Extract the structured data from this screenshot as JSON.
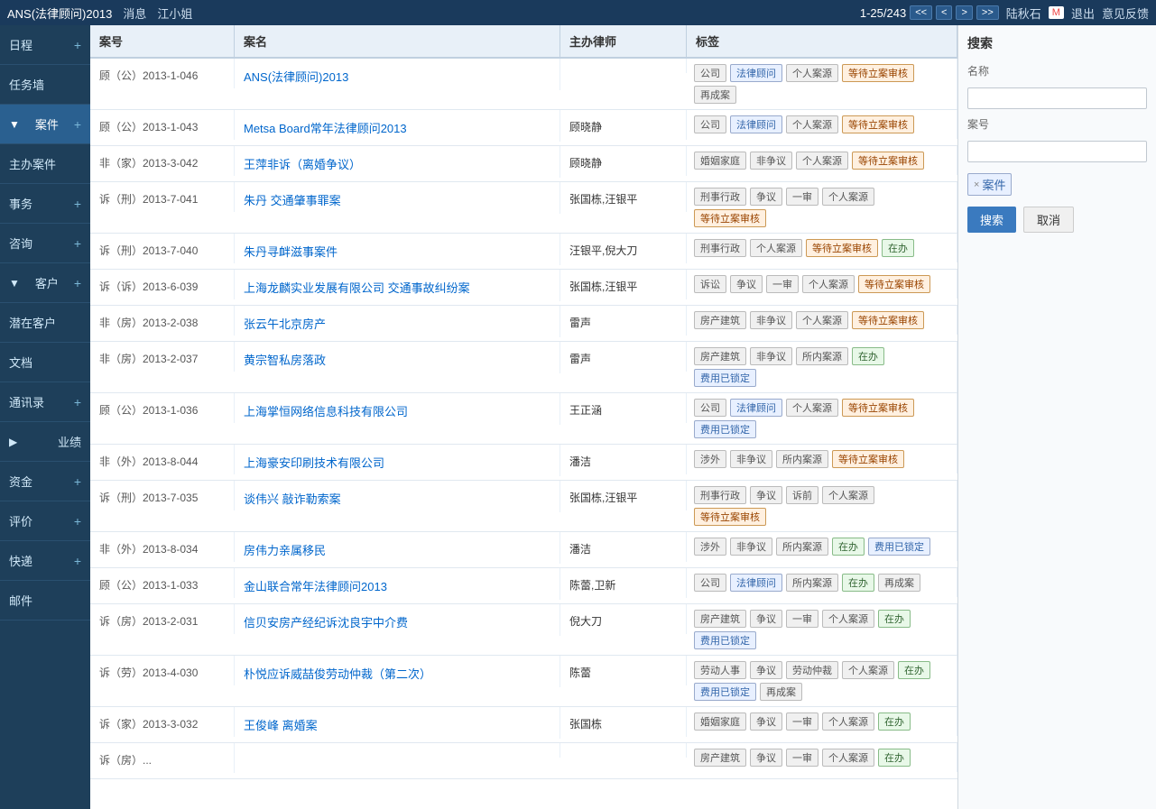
{
  "topbar": {
    "title": "ANS(法律顾问)2013",
    "links": [
      "消息",
      "江小姐"
    ],
    "pagination": "1-25/243",
    "nav_buttons": [
      "<<",
      "<",
      ">",
      ">>"
    ],
    "user": "陆秋石",
    "mail_icon": "M",
    "actions": [
      "退出",
      "意见反馈"
    ]
  },
  "sidebar": {
    "items": [
      {
        "label": "日程",
        "suffix": "+",
        "active": false
      },
      {
        "label": "任务墙",
        "suffix": "",
        "active": false
      },
      {
        "label": "案件",
        "suffix": "+",
        "active": true,
        "arrow": "▼"
      },
      {
        "label": "主办案件",
        "suffix": "",
        "active": false
      },
      {
        "label": "事务",
        "suffix": "+",
        "active": false
      },
      {
        "label": "咨询",
        "suffix": "+",
        "active": false
      },
      {
        "label": "客户",
        "suffix": "+",
        "active": false,
        "arrow": "▼"
      },
      {
        "label": "潜在客户",
        "suffix": "",
        "active": false
      },
      {
        "label": "文档",
        "suffix": "",
        "active": false
      },
      {
        "label": "通讯录",
        "suffix": "+",
        "active": false
      },
      {
        "label": "业绩",
        "suffix": "",
        "active": false,
        "arrow": "▶"
      },
      {
        "label": "资金",
        "suffix": "+",
        "active": false
      },
      {
        "label": "评价",
        "suffix": "+",
        "active": false
      },
      {
        "label": "快递",
        "suffix": "+",
        "active": false
      },
      {
        "label": "邮件",
        "suffix": "",
        "active": false
      }
    ]
  },
  "table": {
    "headers": [
      "案号",
      "案名",
      "主办律师",
      "标签"
    ],
    "rows": [
      {
        "case_no": "顾（公）2013-1-046",
        "case_name": "ANS(法律顾问)2013",
        "lawyer": "",
        "tags": [
          {
            "text": "公司",
            "type": "gray"
          },
          {
            "text": "法律顾问",
            "type": "blue"
          },
          {
            "text": "个人案源",
            "type": "gray"
          },
          {
            "text": "等待立案审核",
            "type": "orange"
          },
          {
            "text": "再成案",
            "type": "gray"
          }
        ]
      },
      {
        "case_no": "顾（公）2013-1-043",
        "case_name": "Metsa Board常年法律顾问2013",
        "lawyer": "顾晓静",
        "tags": [
          {
            "text": "公司",
            "type": "gray"
          },
          {
            "text": "法律顾问",
            "type": "blue"
          },
          {
            "text": "个人案源",
            "type": "gray"
          },
          {
            "text": "等待立案审核",
            "type": "orange"
          }
        ]
      },
      {
        "case_no": "非（家）2013-3-042",
        "case_name": "王萍非诉（离婚争议）",
        "lawyer": "顾晓静",
        "tags": [
          {
            "text": "婚姻家庭",
            "type": "gray"
          },
          {
            "text": "非争议",
            "type": "gray"
          },
          {
            "text": "个人案源",
            "type": "gray"
          },
          {
            "text": "等待立案审核",
            "type": "orange"
          }
        ]
      },
      {
        "case_no": "诉（刑）2013-7-041",
        "case_name": "朱丹 交通肇事罪案",
        "lawyer": "张国栋,汪银平",
        "tags": [
          {
            "text": "刑事行政",
            "type": "gray"
          },
          {
            "text": "争议",
            "type": "gray"
          },
          {
            "text": "一审",
            "type": "gray"
          },
          {
            "text": "个人案源",
            "type": "gray"
          },
          {
            "text": "等待立案审核",
            "type": "orange"
          }
        ]
      },
      {
        "case_no": "诉（刑）2013-7-040",
        "case_name": "朱丹寻衅滋事案件",
        "lawyer": "汪银平,倪大刀",
        "tags": [
          {
            "text": "刑事行政",
            "type": "gray"
          },
          {
            "text": "个人案源",
            "type": "gray"
          },
          {
            "text": "等待立案审核",
            "type": "orange"
          },
          {
            "text": "在办",
            "type": "green"
          }
        ]
      },
      {
        "case_no": "诉（诉）2013-6-039",
        "case_name": "上海龙麟实业发展有限公司 交通事故纠纷案",
        "lawyer": "张国栋,汪银平",
        "tags": [
          {
            "text": "诉讼",
            "type": "gray"
          },
          {
            "text": "争议",
            "type": "gray"
          },
          {
            "text": "一审",
            "type": "gray"
          },
          {
            "text": "个人案源",
            "type": "gray"
          },
          {
            "text": "等待立案审核",
            "type": "orange"
          }
        ]
      },
      {
        "case_no": "非（房）2013-2-038",
        "case_name": "张云午北京房产",
        "lawyer": "雷声",
        "tags": [
          {
            "text": "房产建筑",
            "type": "gray"
          },
          {
            "text": "非争议",
            "type": "gray"
          },
          {
            "text": "个人案源",
            "type": "gray"
          },
          {
            "text": "等待立案审核",
            "type": "orange"
          }
        ]
      },
      {
        "case_no": "非（房）2013-2-037",
        "case_name": "黄宗智私房落政",
        "lawyer": "雷声",
        "tags": [
          {
            "text": "房产建筑",
            "type": "gray"
          },
          {
            "text": "非争议",
            "type": "gray"
          },
          {
            "text": "所内案源",
            "type": "gray"
          },
          {
            "text": "在办",
            "type": "green"
          },
          {
            "text": "费用已锁定",
            "type": "blue"
          }
        ]
      },
      {
        "case_no": "顾（公）2013-1-036",
        "case_name": "上海掌恒网络信息科技有限公司",
        "lawyer": "王正涵",
        "tags": [
          {
            "text": "公司",
            "type": "gray"
          },
          {
            "text": "法律顾问",
            "type": "blue"
          },
          {
            "text": "个人案源",
            "type": "gray"
          },
          {
            "text": "等待立案审核",
            "type": "orange"
          },
          {
            "text": "费用已锁定",
            "type": "blue"
          }
        ]
      },
      {
        "case_no": "非（外）2013-8-044",
        "case_name": "上海豪安印刷技术有限公司",
        "lawyer": "潘洁",
        "tags": [
          {
            "text": "涉外",
            "type": "gray"
          },
          {
            "text": "非争议",
            "type": "gray"
          },
          {
            "text": "所内案源",
            "type": "gray"
          },
          {
            "text": "等待立案审核",
            "type": "orange"
          }
        ]
      },
      {
        "case_no": "诉（刑）2013-7-035",
        "case_name": "谈伟兴 敲诈勒索案",
        "lawyer": "张国栋,汪银平",
        "tags": [
          {
            "text": "刑事行政",
            "type": "gray"
          },
          {
            "text": "争议",
            "type": "gray"
          },
          {
            "text": "诉前",
            "type": "gray"
          },
          {
            "text": "个人案源",
            "type": "gray"
          },
          {
            "text": "等待立案审核",
            "type": "orange"
          }
        ]
      },
      {
        "case_no": "非（外）2013-8-034",
        "case_name": "房伟力亲属移民",
        "lawyer": "潘洁",
        "tags": [
          {
            "text": "涉外",
            "type": "gray"
          },
          {
            "text": "非争议",
            "type": "gray"
          },
          {
            "text": "所内案源",
            "type": "gray"
          },
          {
            "text": "在办",
            "type": "green"
          },
          {
            "text": "费用已锁定",
            "type": "blue"
          }
        ]
      },
      {
        "case_no": "顾（公）2013-1-033",
        "case_name": "金山联合常年法律顾问2013",
        "lawyer": "陈蕾,卫新",
        "tags": [
          {
            "text": "公司",
            "type": "gray"
          },
          {
            "text": "法律顾问",
            "type": "blue"
          },
          {
            "text": "所内案源",
            "type": "gray"
          },
          {
            "text": "在办",
            "type": "green"
          },
          {
            "text": "再成案",
            "type": "gray"
          }
        ]
      },
      {
        "case_no": "诉（房）2013-2-031",
        "case_name": "信贝安房产经纪诉沈良宇中介费",
        "lawyer": "倪大刀",
        "tags": [
          {
            "text": "房产建筑",
            "type": "gray"
          },
          {
            "text": "争议",
            "type": "gray"
          },
          {
            "text": "一审",
            "type": "gray"
          },
          {
            "text": "个人案源",
            "type": "gray"
          },
          {
            "text": "在办",
            "type": "green"
          },
          {
            "text": "费用已锁定",
            "type": "blue"
          }
        ]
      },
      {
        "case_no": "诉（劳）2013-4-030",
        "case_name": "朴悦应诉威喆俊劳动仲裁（第二次）",
        "lawyer": "陈蕾",
        "tags": [
          {
            "text": "劳动人事",
            "type": "gray"
          },
          {
            "text": "争议",
            "type": "gray"
          },
          {
            "text": "劳动仲裁",
            "type": "gray"
          },
          {
            "text": "个人案源",
            "type": "gray"
          },
          {
            "text": "在办",
            "type": "green"
          },
          {
            "text": "费用已锁定",
            "type": "blue"
          },
          {
            "text": "再成案",
            "type": "gray"
          }
        ]
      },
      {
        "case_no": "诉（家）2013-3-032",
        "case_name": "王俊峰 离婚案",
        "lawyer": "张国栋",
        "tags": [
          {
            "text": "婚姻家庭",
            "type": "gray"
          },
          {
            "text": "争议",
            "type": "gray"
          },
          {
            "text": "一审",
            "type": "gray"
          },
          {
            "text": "个人案源",
            "type": "gray"
          },
          {
            "text": "在办",
            "type": "green"
          }
        ]
      },
      {
        "case_no": "诉（房）...",
        "case_name": "",
        "lawyer": "",
        "tags": [
          {
            "text": "房产建筑",
            "type": "gray"
          },
          {
            "text": "争议",
            "type": "gray"
          },
          {
            "text": "一审",
            "type": "gray"
          },
          {
            "text": "个人案源",
            "type": "gray"
          },
          {
            "text": "在办",
            "type": "green"
          }
        ]
      }
    ]
  },
  "search": {
    "title": "搜索",
    "name_label": "名称",
    "name_placeholder": "",
    "case_no_label": "案号",
    "case_no_placeholder": "",
    "tag_filter_label": "案件",
    "tag_filter_remove": "×",
    "btn_search": "搜索",
    "btn_cancel": "取消"
  }
}
